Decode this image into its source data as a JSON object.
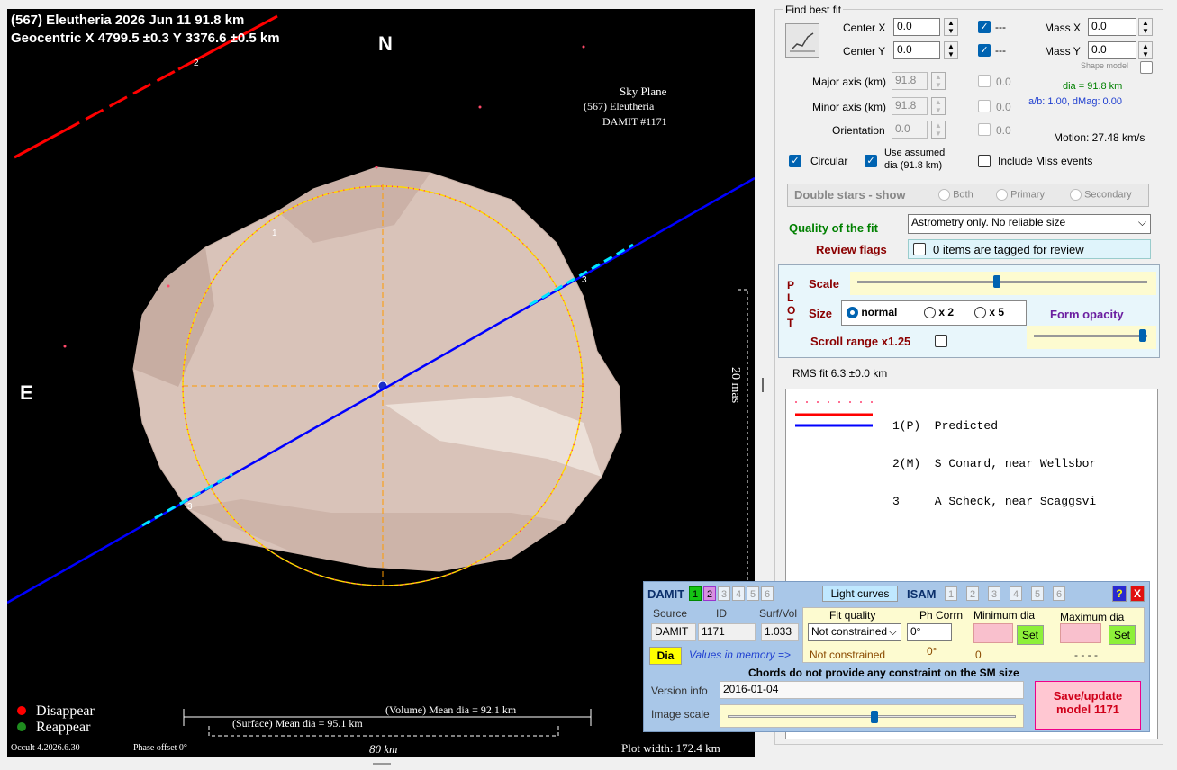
{
  "plot": {
    "header_line1": "(567) Eleutheria  2026 Jun 11  91.8 km",
    "header_line2": "Geocentric X 4799.5 ±0.3 Y 3376.6 ±0.5 km",
    "north": "N",
    "east": "E",
    "sky_title": "Sky Plane",
    "sky_object": "(567) Eleutheria",
    "sky_damit": "DAMIT #1171",
    "scale_label": "20 mas",
    "chord_labels": [
      "1",
      "2",
      "3",
      "3"
    ],
    "volume_dia": "(Volume) Mean dia = 92.1 km",
    "surface_dia": "(Surface) Mean dia = 95.1 km",
    "distance": "80 km",
    "plot_width": "Plot width: 172.4 km",
    "version": "Occult 4.2026.6.30",
    "phase_offset": "Phase offset 0°",
    "legend_disappear": "Disappear",
    "legend_reappear": "Reappear",
    "colors": {
      "disappear": "#ff0000",
      "reappear": "#1e8c1e",
      "chord2": "#ff0000",
      "chord3": "#0000ff",
      "fit": "#ffd700"
    }
  },
  "fit": {
    "title": "Find best fit",
    "center_x_label": "Center X",
    "center_x": "0.0",
    "center_y_label": "Center Y",
    "center_y": "0.0",
    "mass_x_label": "Mass X",
    "mass_x": "0.0",
    "mass_y_label": "Mass Y",
    "mass_y": "0.0",
    "dash": "---",
    "shape_model": "Shape model",
    "major_label": "Major axis (km)",
    "major": "91.8",
    "minor_label": "Minor axis (km)",
    "minor": "91.8",
    "orient_label": "Orientation",
    "orient": "0.0",
    "zero": "0.0",
    "dia": "dia = 91.8 km",
    "ab": "a/b: 1.00, dMag: 0.00",
    "motion": "Motion: 27.48 km/s",
    "circular": "Circular",
    "use_assumed": "Use assumed",
    "use_assumed2": "dia (91.8 km)",
    "include_miss": "Include Miss events",
    "double_stars": "Double stars - show",
    "both": "Both",
    "primary": "Primary",
    "secondary": "Secondary",
    "quality_label": "Quality of the fit",
    "quality_value": "Astrometry only. No reliable size",
    "review_label": "Review flags",
    "review_value": "0 items are tagged for review"
  },
  "plotctl": {
    "vertical": [
      "P",
      "L",
      "O",
      "T"
    ],
    "scale": "Scale",
    "size": "Size",
    "normal": "normal",
    "x2": "x 2",
    "x5": "x 5",
    "form_opacity": "Form opacity",
    "scroll_range": "Scroll range x1.25",
    "scale_level": 0.48,
    "opacity_level": 0.96
  },
  "rms": "RMS fit 6.3 ±0.0 km",
  "chords": [
    {
      "text": "1(P)  Predicted"
    },
    {
      "text": "2(M)  S Conard, near Wellsbor"
    },
    {
      "text": "3     A Scheck, near Scaggsvi"
    }
  ],
  "damit": {
    "title": "DAMIT",
    "nums": [
      "1",
      "2",
      "3",
      "4",
      "5",
      "6"
    ],
    "light_curves": "Light curves",
    "isam": "ISAM",
    "isam_nums": [
      "1",
      "2",
      "3",
      "4",
      "5",
      "6"
    ],
    "help": "?",
    "close": "X",
    "hdr_source": "Source",
    "hdr_id": "ID",
    "hdr_surf": "Surf/Vol",
    "hdr_fit": "Fit quality",
    "hdr_phcorr": "Ph Corrn",
    "hdr_min": "Minimum dia",
    "hdr_max": "Maximum dia",
    "source": "DAMIT",
    "id": "1171",
    "surf": "1.033",
    "fit_select": "Not constrained",
    "phcorr": "0°",
    "set": "Set",
    "dia_btn": "Dia",
    "in_memory": "Values in memory =>",
    "mem_fit": "Not constrained",
    "mem_phcorr": "0°",
    "mem_min": "0",
    "mem_max": "- - - -",
    "chords_note": "Chords do not provide any constraint on the SM size",
    "version_label": "Version info",
    "version": "2016-01-04",
    "image_scale": "Image scale",
    "image_scale_level": 0.51,
    "save": "Save/update",
    "save2": "model 1171"
  }
}
